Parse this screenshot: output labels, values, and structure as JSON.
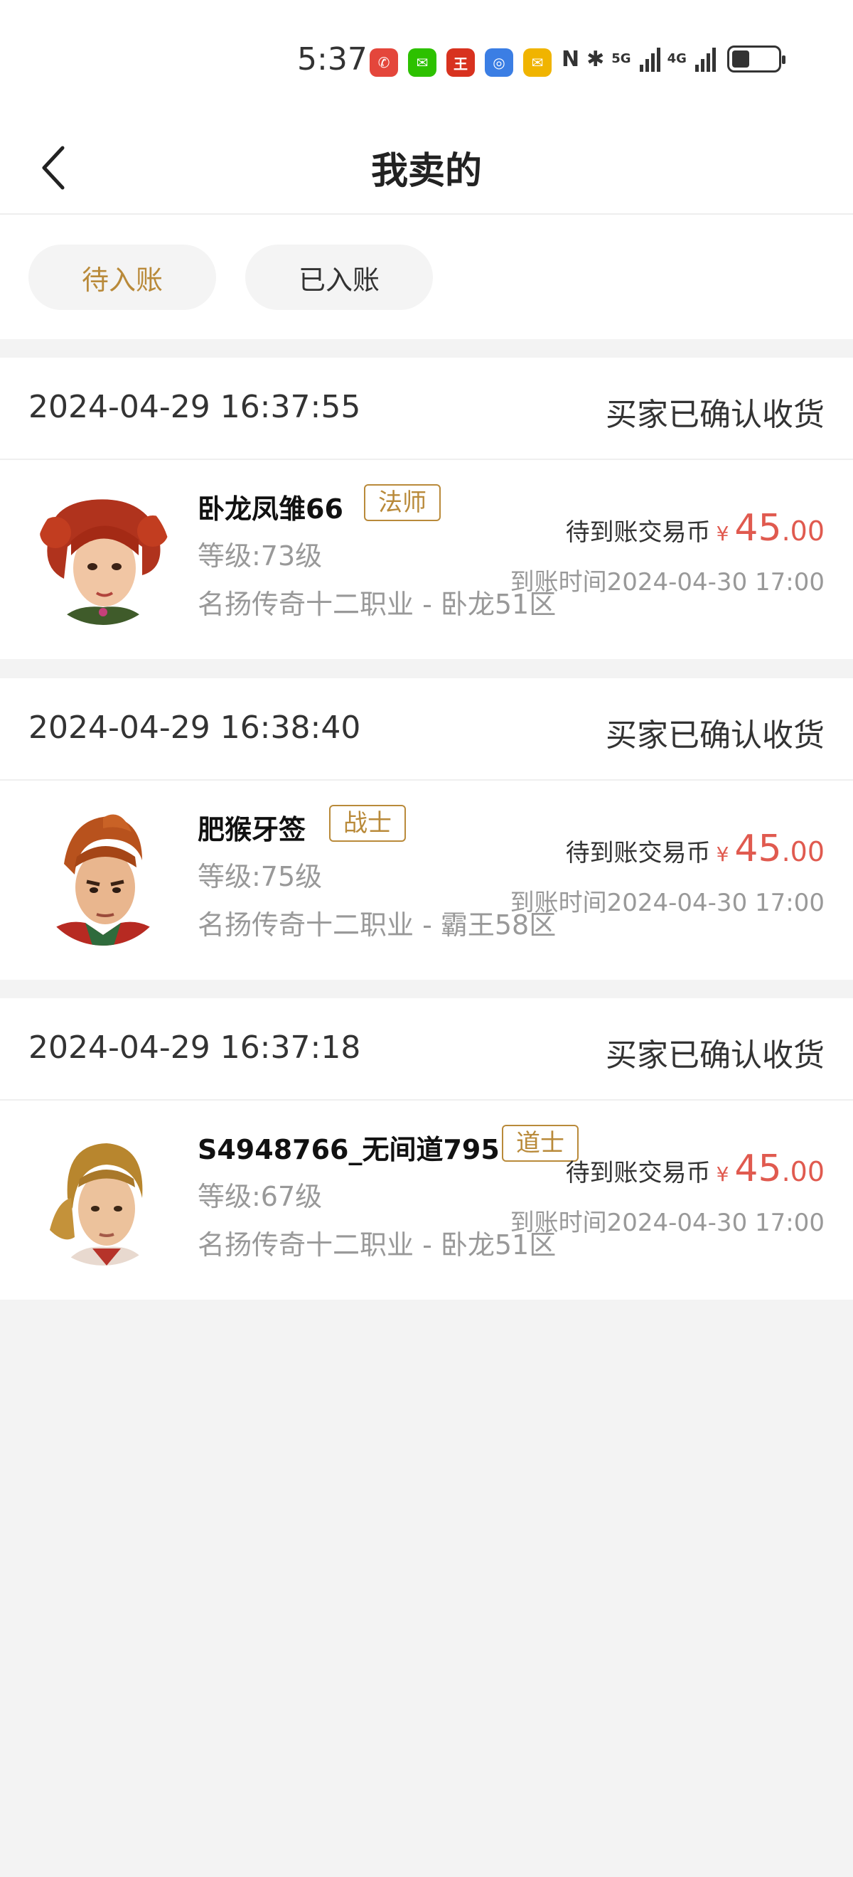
{
  "status_bar": {
    "time": "5:37",
    "apps": [
      {
        "icon": "missed-call-icon",
        "color": "#e4463b",
        "glyph": "✆"
      },
      {
        "icon": "wechat-icon",
        "color": "#2dc100",
        "glyph": "✉"
      },
      {
        "icon": "game-app-icon",
        "color": "#d8321f",
        "glyph": "王"
      },
      {
        "icon": "app-icon",
        "color": "#3b7ee4",
        "glyph": "◎"
      },
      {
        "icon": "mail-icon",
        "color": "#f0b400",
        "glyph": "✉"
      }
    ],
    "nfc": "N",
    "bluetooth": "✱",
    "network1": "5G",
    "network2": "4G"
  },
  "header": {
    "title": "我卖的"
  },
  "tabs": [
    {
      "label": "待入账",
      "active": true
    },
    {
      "label": "已入账",
      "active": false
    }
  ],
  "orders": [
    {
      "date": "2024-04-29 16:37:55",
      "status": "买家已确认收货",
      "name": "卧龙凤雏66",
      "class_tag": "法师",
      "level": "等级:73级",
      "server": "名扬传奇十二职业 - 卧龙51区",
      "pending_label": "待到账交易币",
      "currency": "¥",
      "amount_int": "45",
      "amount_dec": ".00",
      "arrive_time": "到账时间2024-04-30 17:00"
    },
    {
      "date": "2024-04-29 16:38:40",
      "status": "买家已确认收货",
      "name": "肥猴牙签",
      "class_tag": "战士",
      "level": "等级:75级",
      "server": "名扬传奇十二职业 - 霸王58区",
      "pending_label": "待到账交易币",
      "currency": "¥",
      "amount_int": "45",
      "amount_dec": ".00",
      "arrive_time": "到账时间2024-04-30 17:00"
    },
    {
      "date": "2024-04-29 16:37:18",
      "status": "买家已确认收货",
      "name": "S4948766_无间道795",
      "class_tag": "道士",
      "level": "等级:67级",
      "server": "名扬传奇十二职业 - 卧龙51区",
      "pending_label": "待到账交易币",
      "currency": "¥",
      "amount_int": "45",
      "amount_dec": ".00",
      "arrive_time": "到账时间2024-04-30 17:00"
    }
  ],
  "colors": {
    "accent": "#b98a3a",
    "price": "#e05a4f",
    "muted": "#999999"
  }
}
